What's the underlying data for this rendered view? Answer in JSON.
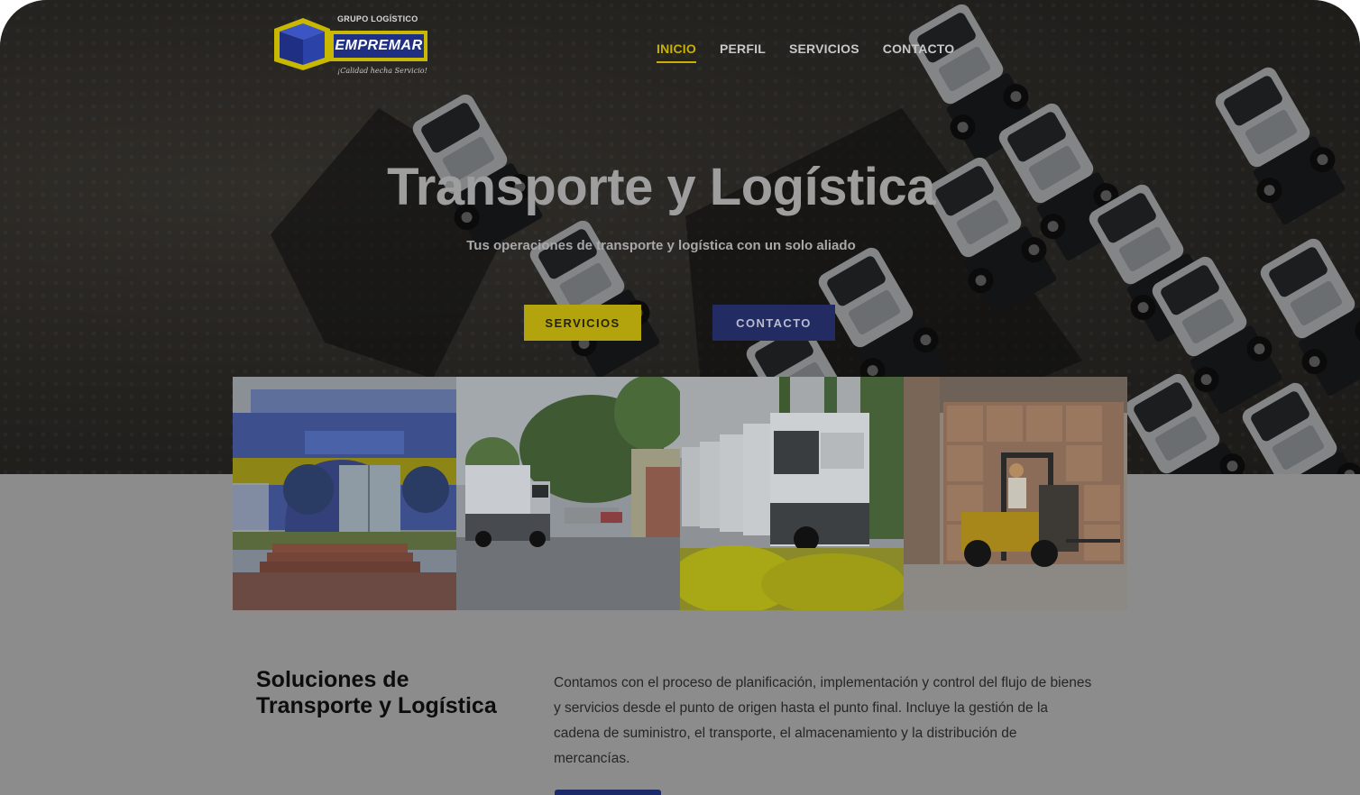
{
  "brand": {
    "group_label": "GRUPO LOGÍSTICO",
    "name": "EMPREMAR",
    "tagline": "¡Calidad hecha Servicio!"
  },
  "nav": {
    "items": [
      {
        "label": "INICIO",
        "active": true
      },
      {
        "label": "PERFIL",
        "active": false
      },
      {
        "label": "SERVICIOS",
        "active": false
      },
      {
        "label": "CONTACTO",
        "active": false
      }
    ]
  },
  "hero": {
    "title": "Transporte y Logística",
    "subtitle": "Tus operaciones de transporte y logística con un solo aliado",
    "buttons": {
      "services_label": "SERVICIOS",
      "contact_label": "CONTACTO"
    }
  },
  "gallery": {
    "photos": [
      {
        "name": "office-building-photo"
      },
      {
        "name": "truck-yard-photo"
      },
      {
        "name": "truck-fleet-photo"
      },
      {
        "name": "forklift-warehouse-photo"
      }
    ]
  },
  "intro": {
    "title": "Soluciones de Transporte y Logística",
    "body": "Contamos con el proceso de planificación, implementación y control del flujo de bienes y servicios desde el punto de origen hasta el punto final. Incluye la gestión de la cadena de suministro, el transporte, el almacenamiento y la distribución de mercancías."
  },
  "colors": {
    "accent_yellow": "#c8b100",
    "brand_blue": "#1f2f84",
    "overlay_gray": "#8c8c8c"
  }
}
